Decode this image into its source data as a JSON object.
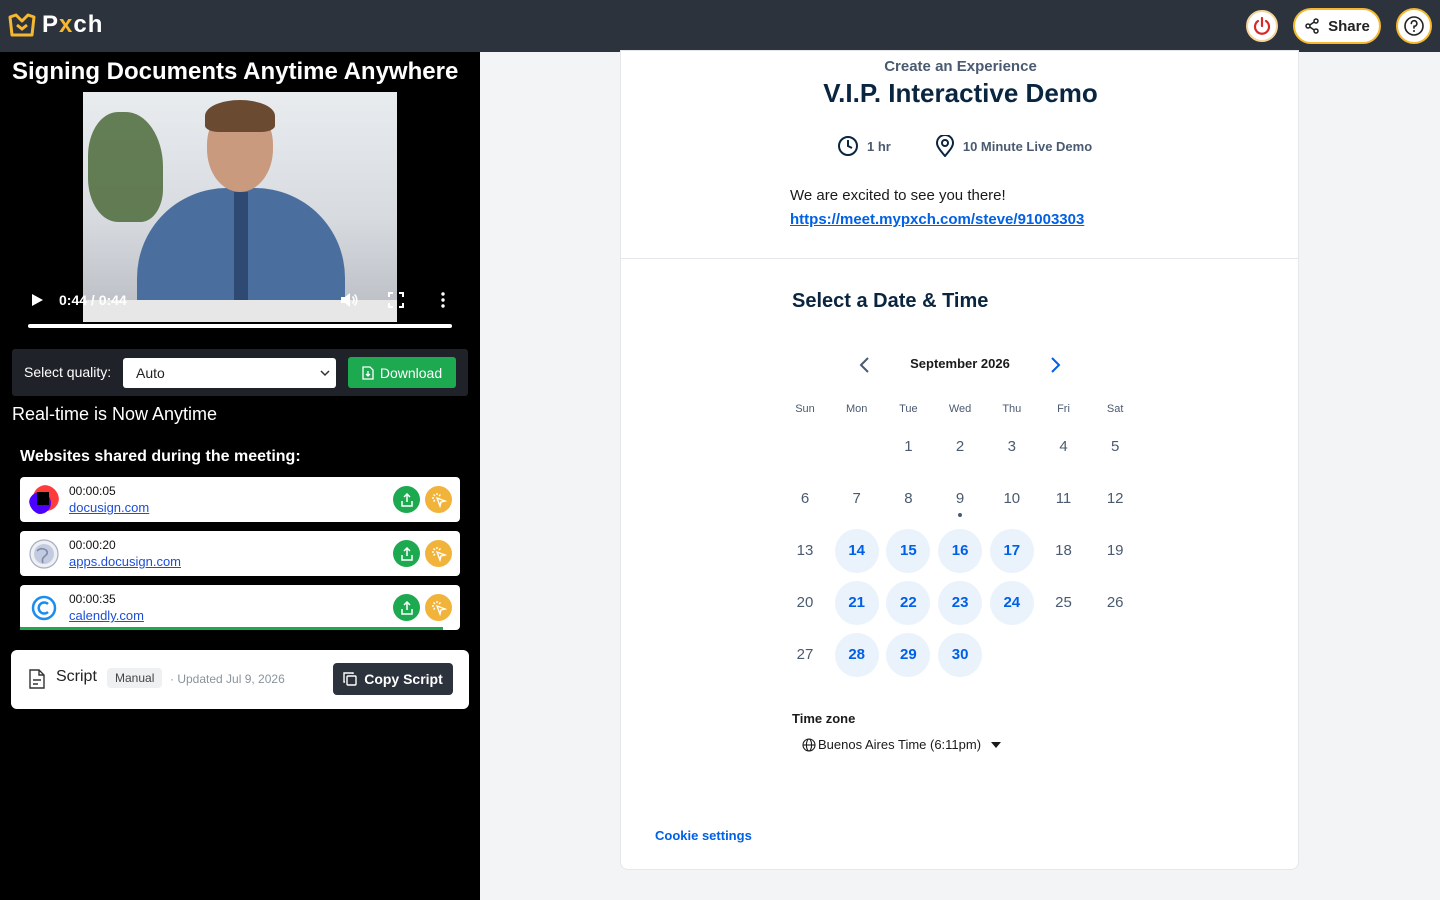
{
  "app": {
    "logo_prefix": "P",
    "logo_x": "x",
    "logo_suffix": "ch",
    "share_label": "Share",
    "accent": "#f5b82e",
    "topbar_bg": "#2c333d"
  },
  "left": {
    "title": "Signing Documents Anytime Anywhere",
    "video": {
      "time": "0:44 / 0:44",
      "progress_fraction": 1.0
    },
    "quality": {
      "label": "Select quality:",
      "selected": "Auto",
      "download_label": "Download"
    },
    "subtitle": "Real-time is Now Anytime",
    "sites_heading": "Websites shared during the meeting:",
    "sites": [
      {
        "time": "00:00:05",
        "url": "docusign.com",
        "icon": "docusign-icon"
      },
      {
        "time": "00:00:20",
        "url": "apps.docusign.com",
        "icon": "globe-icon"
      },
      {
        "time": "00:00:35",
        "url": "calendly.com",
        "icon": "calendly-icon"
      }
    ],
    "script": {
      "label": "Script",
      "badge": "Manual",
      "updated": "· Updated Jul 9, 2026",
      "copy_label": "Copy Script"
    }
  },
  "booking": {
    "eyebrow": "Create an Experience",
    "title": "V.I.P. Interactive Demo",
    "duration": "1 hr",
    "location": "10 Minute Live Demo",
    "welcome": "We are excited to see you there!",
    "link": "https://meet.mypxch.com/steve/91003303",
    "select_title": "Select a Date & Time",
    "month": "September 2026",
    "weekdays": [
      "Sun",
      "Mon",
      "Tue",
      "Wed",
      "Thu",
      "Fri",
      "Sat"
    ],
    "weeks": [
      [
        "",
        "",
        "1",
        "2",
        "3",
        "4",
        "5"
      ],
      [
        "6",
        "7",
        "8",
        "9",
        "10",
        "11",
        "12"
      ],
      [
        "13",
        "14",
        "15",
        "16",
        "17",
        "18",
        "19"
      ],
      [
        "20",
        "21",
        "22",
        "23",
        "24",
        "25",
        "26"
      ],
      [
        "27",
        "28",
        "29",
        "30",
        "",
        "",
        ""
      ]
    ],
    "available_days": [
      "14",
      "15",
      "16",
      "17",
      "21",
      "22",
      "23",
      "24",
      "28",
      "29",
      "30"
    ],
    "today": "9",
    "timezone_label": "Time zone",
    "timezone_value": "Buenos Aires Time (6:11pm)",
    "cookie": "Cookie settings",
    "link_color": "#0060e6"
  }
}
